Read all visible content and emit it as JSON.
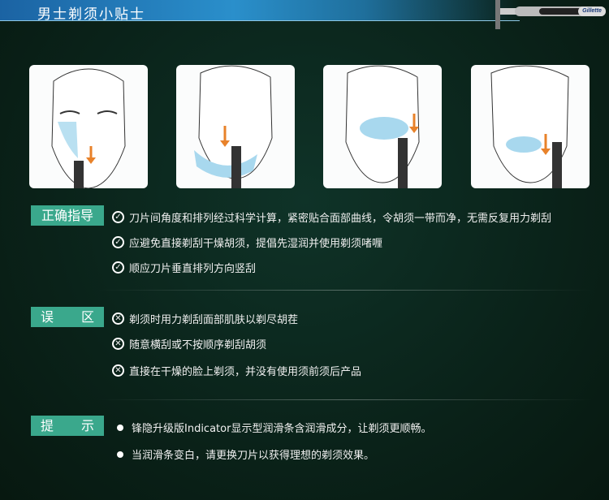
{
  "header": {
    "title": "男士剃须小贴士"
  },
  "razor": {
    "brand": "Gillette"
  },
  "steps": [
    {
      "icon": "face-cheek-shave"
    },
    {
      "icon": "face-chin-shave"
    },
    {
      "icon": "face-lip-shave"
    },
    {
      "icon": "face-jaw-shave"
    }
  ],
  "sections": [
    {
      "label": "正确指导",
      "icon": "check-circle-icon",
      "items": [
        "刀片间角度和排列经过科学计算，紧密贴合面部曲线，令胡须一带而净，无需反复用力剃刮",
        "应避免直接剃刮干燥胡须，提倡先湿润并使用剃须啫喱",
        "顺应刀片垂直排列方向竖刮"
      ]
    },
    {
      "label": "误　区",
      "icon": "x-circle-icon",
      "items": [
        "剃须时用力剃刮面部肌肤以剃尽胡茬",
        "随意横刮或不按顺序剃刮胡须",
        "直接在干燥的脸上剃须，并没有使用须前须后产品"
      ]
    },
    {
      "label": "提　示",
      "icon": "bullet-icon",
      "items": [
        "锋隐升级版Indicator显示型润滑条含润滑成分，让剃须更顺畅。",
        "当润滑条变白，请更换刀片以获得理想的剃须效果。"
      ]
    }
  ],
  "colors": {
    "label_bg": "#3aa88c",
    "header": "#2a8fcb",
    "foam": "#a8d8ee",
    "arrow": "#e8822a"
  }
}
